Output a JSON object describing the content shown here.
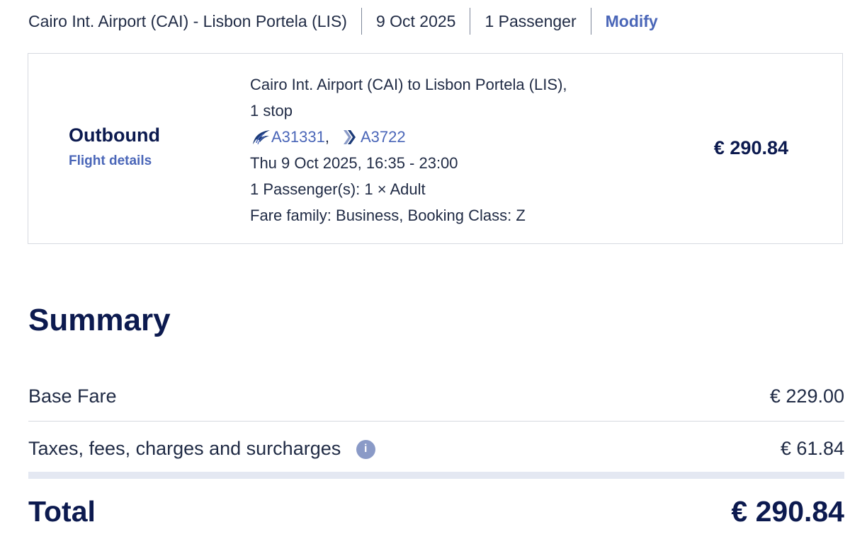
{
  "search_bar": {
    "route": "Cairo Int. Airport (CAI) - Lisbon Portela (LIS)",
    "date": "9 Oct 2025",
    "passengers": "1 Passenger",
    "modify_label": "Modify"
  },
  "outbound": {
    "title": "Outbound",
    "details_link": "Flight details",
    "route_line": "Cairo Int. Airport (CAI) to Lisbon Portela (LIS),",
    "stops": "1 stop",
    "flights": [
      {
        "number": "A31331",
        "separator": ",",
        "airline_icon": "egyptair-falcon-icon"
      },
      {
        "number": "A3722",
        "separator": "",
        "airline_icon": "aegean-chevron-icon"
      }
    ],
    "schedule": "Thu 9 Oct 2025, 16:35 - 23:00",
    "passengers": "1 Passenger(s): 1 × Adult",
    "fare": "Fare family: Business, Booking Class: Z",
    "price": "€ 290.84"
  },
  "summary": {
    "title": "Summary",
    "base_fare_label": "Base Fare",
    "base_fare_value": "€ 229.00",
    "taxes_label": "Taxes, fees, charges and surcharges",
    "taxes_info_icon": "info-icon",
    "taxes_value": "€ 61.84",
    "total_label": "Total",
    "total_value": "€ 290.84"
  },
  "colors": {
    "primary_text": "#0c1a4f",
    "link": "#4a66b8",
    "info_icon_bg": "#8a9ac7"
  }
}
